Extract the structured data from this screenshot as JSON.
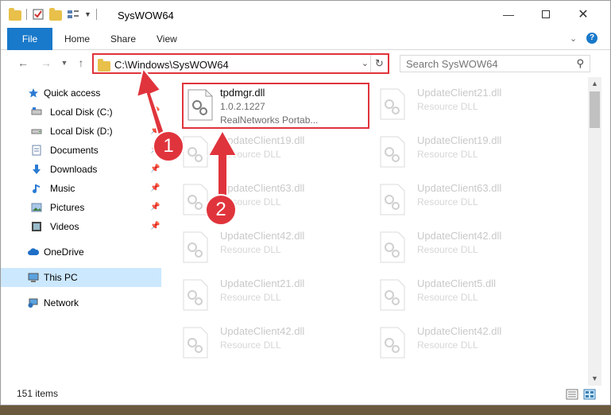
{
  "window": {
    "title": "SysWOW64",
    "controls": [
      "minimize",
      "maximize",
      "close"
    ]
  },
  "ribbon": {
    "tabs": [
      {
        "label": "File",
        "active": true
      },
      {
        "label": "Home"
      },
      {
        "label": "Share"
      },
      {
        "label": "View"
      }
    ]
  },
  "navigation": {
    "address": "C:\\Windows\\SysWOW64",
    "search_placeholder": "Search SysWOW64"
  },
  "sidebar": {
    "quick_access": {
      "label": "Quick access"
    },
    "pinned": [
      {
        "label": "Local Disk (C:)",
        "icon": "drive-icon"
      },
      {
        "label": "Local Disk (D:)",
        "icon": "drive-icon"
      },
      {
        "label": "Documents",
        "icon": "documents-icon"
      },
      {
        "label": "Downloads",
        "icon": "download-icon"
      },
      {
        "label": "Music",
        "icon": "music-icon"
      },
      {
        "label": "Pictures",
        "icon": "pictures-icon"
      },
      {
        "label": "Videos",
        "icon": "videos-icon"
      }
    ],
    "onedrive": {
      "label": "OneDrive"
    },
    "thispc": {
      "label": "This PC",
      "selected": true
    },
    "network": {
      "label": "Network"
    }
  },
  "files": {
    "highlighted": {
      "name": "tpdmgr.dll",
      "version": "1.0.2.1227",
      "description": "RealNetworks Portab..."
    },
    "left": [
      {
        "name": "UpdateClient19.dll",
        "type": "Resource DLL"
      },
      {
        "name": "UpdateClient63.dll",
        "type": "Resource DLL"
      },
      {
        "name": "UpdateClient42.dll",
        "type": "Resource DLL"
      },
      {
        "name": "UpdateClient21.dll",
        "type": "Resource DLL"
      },
      {
        "name": "UpdateClient42.dll",
        "type": "Resource DLL"
      }
    ],
    "right": [
      {
        "name": "UpdateClient21.dll",
        "type": "Resource DLL"
      },
      {
        "name": "UpdateClient19.dll",
        "type": "Resource DLL"
      },
      {
        "name": "UpdateClient63.dll",
        "type": "Resource DLL"
      },
      {
        "name": "UpdateClient42.dll",
        "type": "Resource DLL"
      },
      {
        "name": "UpdateClient5.dll",
        "type": "Resource DLL"
      },
      {
        "name": "UpdateClient42.dll",
        "type": "Resource DLL"
      }
    ]
  },
  "status": {
    "item_count": "151 items"
  },
  "annotations": {
    "step1": "1",
    "step2": "2",
    "color": "#e0343c"
  }
}
